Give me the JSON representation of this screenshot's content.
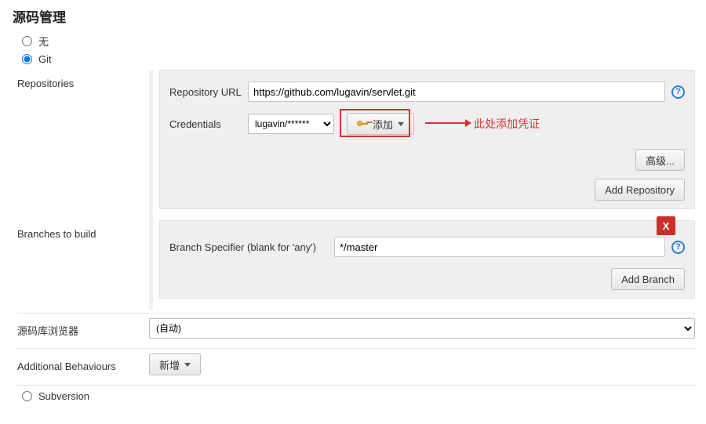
{
  "section_title": "源码管理",
  "scm": {
    "none_label": "无",
    "git_label": "Git",
    "svn_label": "Subversion",
    "selected": "git"
  },
  "git": {
    "repositories_title": "Repositories",
    "repo_url_label": "Repository URL",
    "repo_url_value": "https://github.com/lugavin/servlet.git",
    "credentials_label": "Credentials",
    "credentials_selected": "lugavin/******",
    "add_button_label": "添加",
    "annotation_text": "此处添加凭证",
    "advanced_button": "高级...",
    "add_repo_button": "Add Repository",
    "branches_title": "Branches to build",
    "branch_spec_label": "Branch Specifier (blank for 'any')",
    "branch_spec_value": "*/master",
    "add_branch_button": "Add Branch",
    "delete_label": "X",
    "browser_label": "源码库浏览器",
    "browser_selected": "(自动)",
    "behaviours_label": "Additional Behaviours",
    "behaviours_add": "新增"
  },
  "help": "?"
}
